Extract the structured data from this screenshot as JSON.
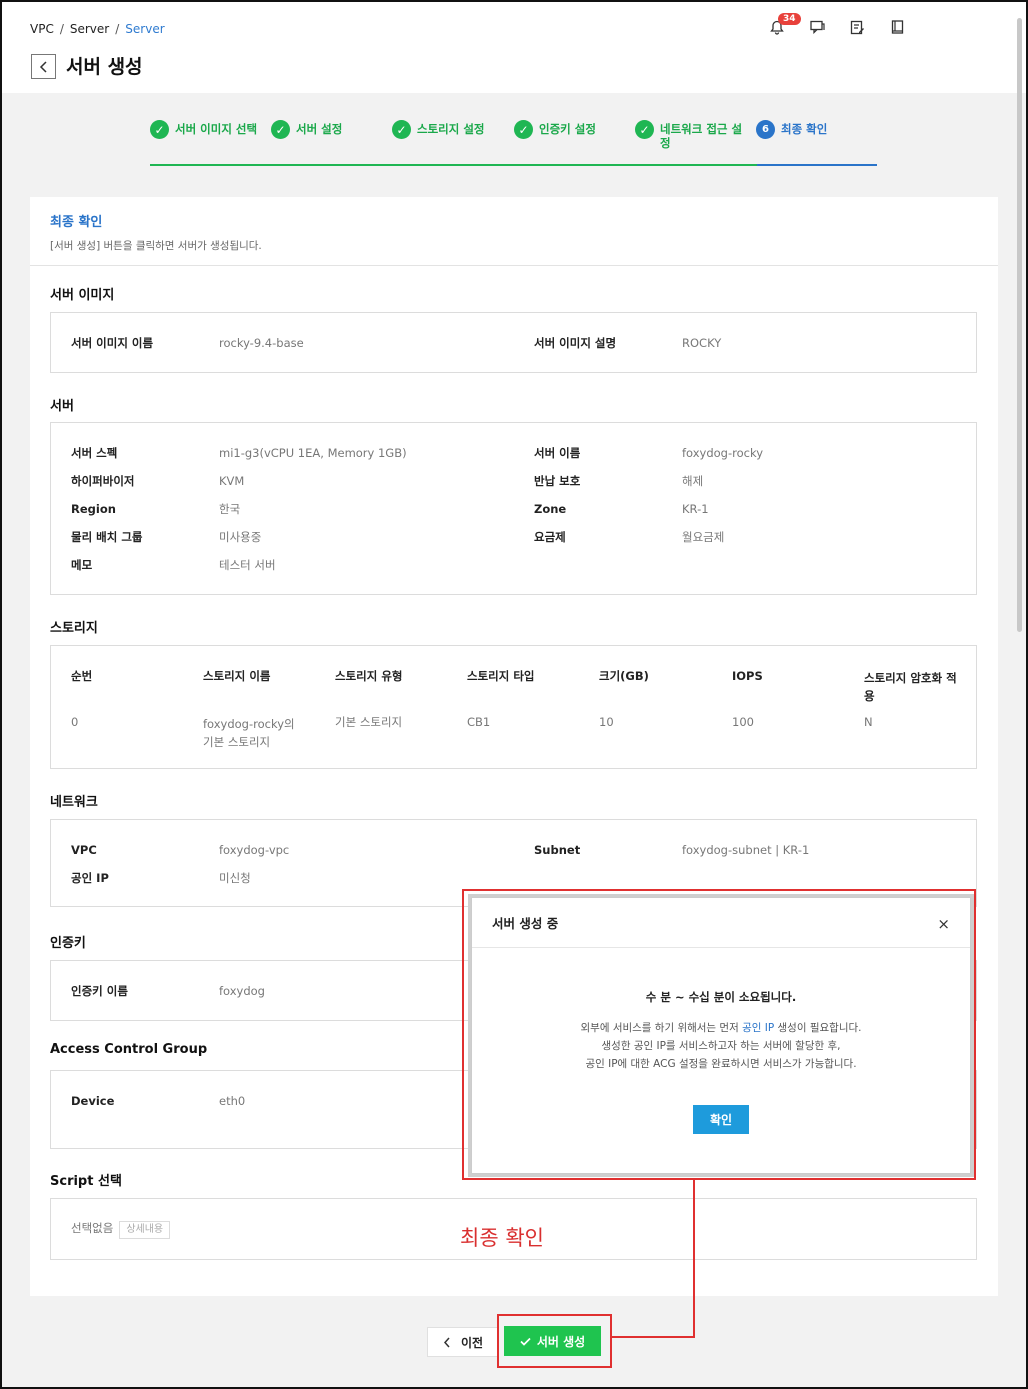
{
  "breadcrumb": [
    "VPC",
    "Server",
    "Server"
  ],
  "notification_count": "34",
  "page_title": "서버 생성",
  "steps": [
    {
      "label": "서버 이미지 선택"
    },
    {
      "label": "서버 설정"
    },
    {
      "label": "스토리지 설정"
    },
    {
      "label": "인증키 설정"
    },
    {
      "label": "네트워크 접근 설정"
    },
    {
      "number": "6",
      "label": "최종 확인"
    }
  ],
  "card": {
    "title": "최종 확인",
    "desc": "[서버 생성] 버튼을 클릭하면 서버가 생성됩니다."
  },
  "server_image": {
    "title": "서버 이미지",
    "name_label": "서버 이미지 이름",
    "name": "rocky-9.4-base",
    "desc_label": "서버 이미지 설명",
    "desc": "ROCKY"
  },
  "server": {
    "title": "서버",
    "spec_label": "서버 스펙",
    "spec": "mi1-g3(vCPU 1EA, Memory 1GB)",
    "name_label": "서버 이름",
    "name": "foxydog-rocky",
    "hypervisor_label": "하이퍼바이저",
    "hypervisor": "KVM",
    "return_label": "반납 보호",
    "return": "해제",
    "region_label": "Region",
    "region": "한국",
    "zone_label": "Zone",
    "zone": "KR-1",
    "placement_label": "물리 배치 그룹",
    "placement": "미사용중",
    "plan_label": "요금제",
    "plan": "월요금제",
    "memo_label": "메모",
    "memo": "테스터 서버"
  },
  "storage": {
    "title": "스토리지",
    "headers": [
      "순번",
      "스토리지 이름",
      "스토리지 유형",
      "스토리지 타입",
      "크기(GB)",
      "IOPS",
      "스토리지 암호화 적용"
    ],
    "row": [
      "0",
      "foxydog-rocky의 기본 스토리지",
      "기본 스토리지",
      "CB1",
      "10",
      "100",
      "N"
    ]
  },
  "network": {
    "title": "네트워크",
    "vpc_label": "VPC",
    "vpc": "foxydog-vpc",
    "subnet_label": "Subnet",
    "subnet": "foxydog-subnet | KR-1",
    "ip_label": "공인 IP",
    "ip": "미신청"
  },
  "auth": {
    "title": "인증키",
    "name_label": "인증키 이름",
    "name": "foxydog"
  },
  "acg": {
    "title": "Access Control Group",
    "device_label": "Device",
    "device": "eth0"
  },
  "script": {
    "title": "Script 선택",
    "value": "선택없음",
    "detail": "상세내용"
  },
  "modal": {
    "title": "서버 생성 중",
    "close": "×",
    "main": "수 분 ~ 수십 분이 소요됩니다.",
    "line1_pre": "외부에 서비스를 하기 위해서는 먼저 ",
    "line1_link": "공인 IP",
    "line1_post": " 생성이 필요합니다.",
    "line2": "생성한 공인 IP를 서비스하고자 하는 서버에 할당한 후,",
    "line3": "공인 IP에 대한 ACG 설정을 완료하시면 서비스가 가능합니다.",
    "ok": "확인"
  },
  "annotation": "최종 확인",
  "buttons": {
    "prev": "이전",
    "create": "서버 생성"
  },
  "colors": {
    "accent_green": "#1fb653",
    "accent_blue": "#2a74c9",
    "annotation_red": "#e03030",
    "modal_button": "#1e9bdc"
  }
}
